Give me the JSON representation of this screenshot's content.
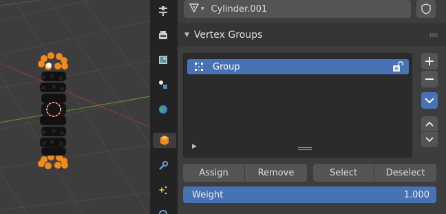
{
  "object": {
    "name": "Cylinder.001"
  },
  "vertex_groups": {
    "title": "Vertex Groups",
    "items": [
      {
        "label": "Group",
        "selected": true
      }
    ],
    "buttons": {
      "assign": "Assign",
      "remove": "Remove",
      "select": "Select",
      "deselect": "Deselect"
    },
    "weight": {
      "label": "Weight",
      "value": "1.000"
    }
  },
  "tabs": [
    "tool-icon",
    "render-icon",
    "output-icon",
    "view-layer-icon",
    "world-icon",
    "object-icon",
    "modifier-icon",
    "particles-icon",
    "physics-icon"
  ],
  "colors": {
    "accent": "#4772b3",
    "selected_vertex": "#f08a1c",
    "panel_bg": "#3d3d3d",
    "list_bg": "#2b2b2b",
    "button_bg": "#545454"
  }
}
